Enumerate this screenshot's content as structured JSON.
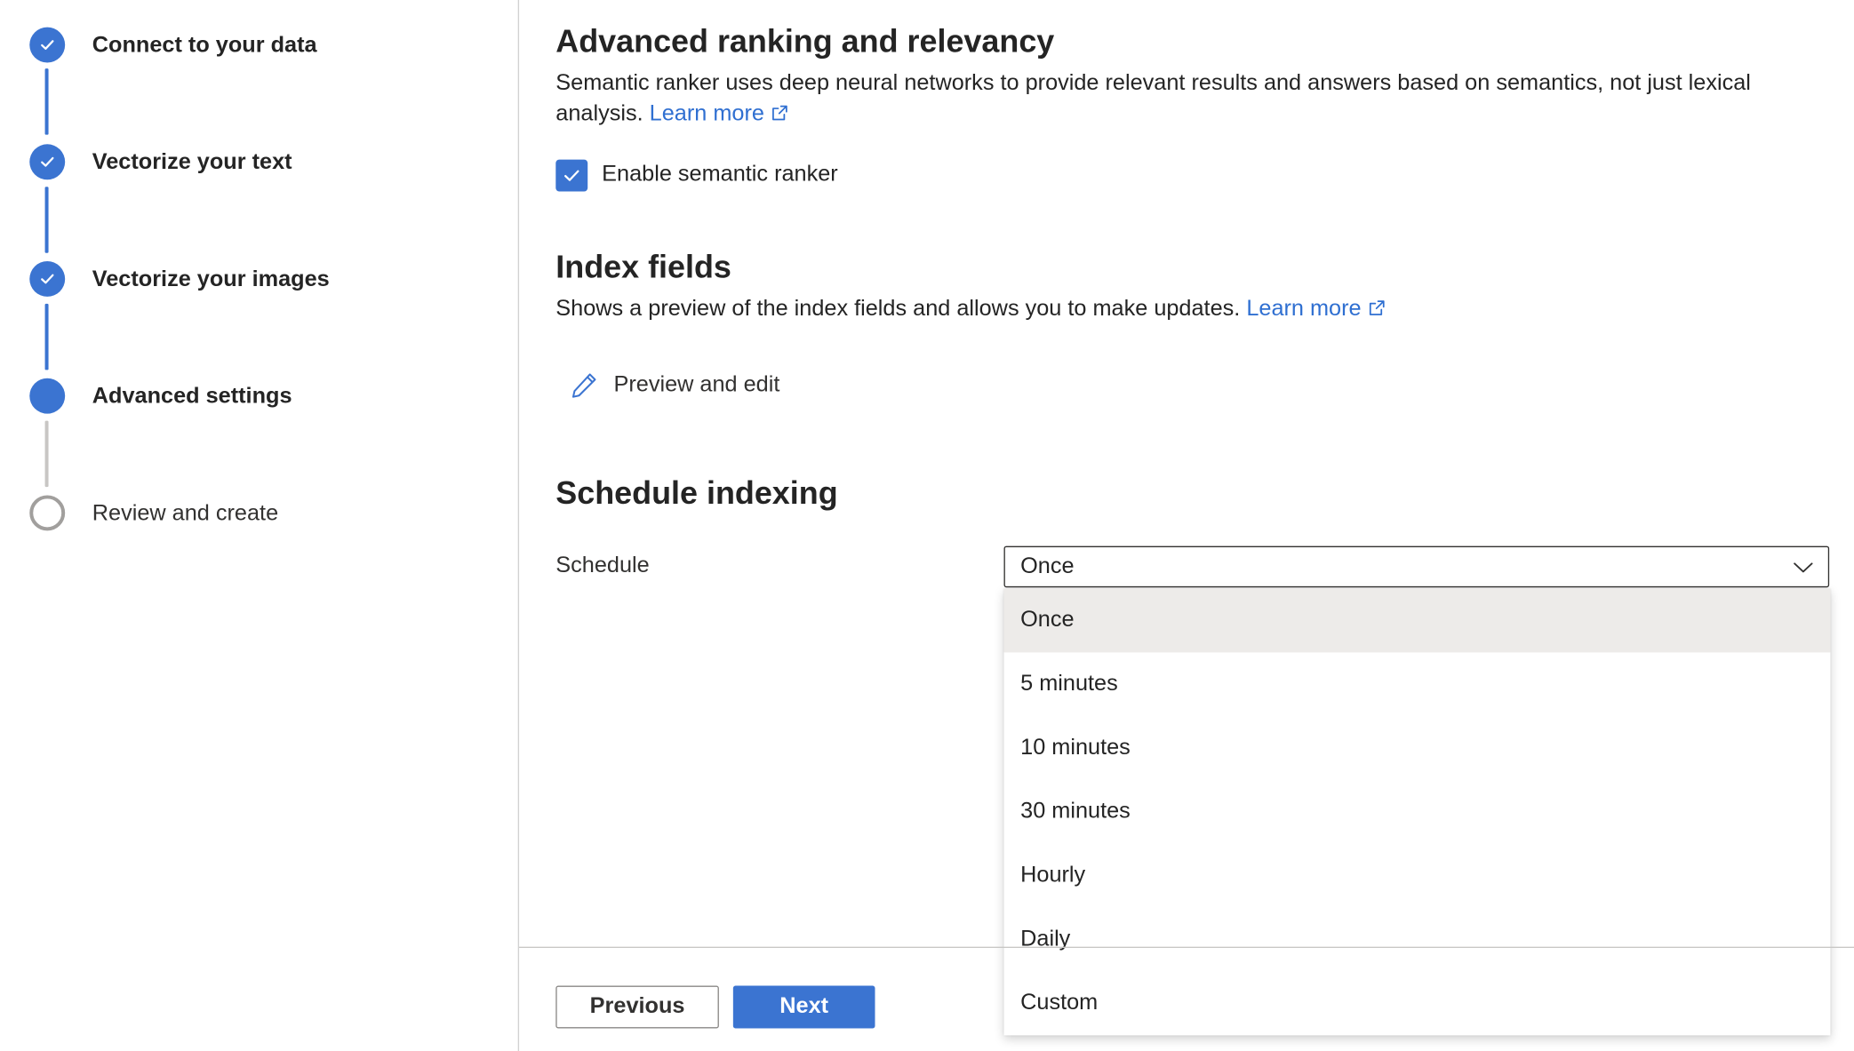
{
  "colors": {
    "accent": "#3b74d1",
    "link": "#2f6fd1",
    "pending": "#a19f9d",
    "selected_option_bg": "#edebe9"
  },
  "steps": [
    {
      "label": "Connect to your data",
      "state": "done"
    },
    {
      "label": "Vectorize your text",
      "state": "done"
    },
    {
      "label": "Vectorize your images",
      "state": "done"
    },
    {
      "label": "Advanced settings",
      "state": "current"
    },
    {
      "label": "Review and create",
      "state": "todo"
    }
  ],
  "ranking": {
    "title": "Advanced ranking and relevancy",
    "description": "Semantic ranker uses deep neural networks to provide relevant results and answers based on semantics, not just lexical analysis.",
    "learn_more": "Learn more",
    "checkbox_label": "Enable semantic ranker",
    "checkbox_checked": true
  },
  "index_fields": {
    "title": "Index fields",
    "description": "Shows a preview of the index fields and allows you to make updates.",
    "learn_more": "Learn more",
    "preview_button": "Preview and edit"
  },
  "schedule": {
    "title": "Schedule indexing",
    "label": "Schedule",
    "selected": "Once",
    "options": [
      "Once",
      "5 minutes",
      "10 minutes",
      "30 minutes",
      "Hourly",
      "Daily",
      "Custom"
    ]
  },
  "footer": {
    "previous": "Previous",
    "next": "Next"
  },
  "icons": {
    "step_done": "checkmark-icon",
    "external_link": "external-link-icon",
    "edit": "pencil-icon",
    "dropdown": "chevron-down-icon"
  }
}
